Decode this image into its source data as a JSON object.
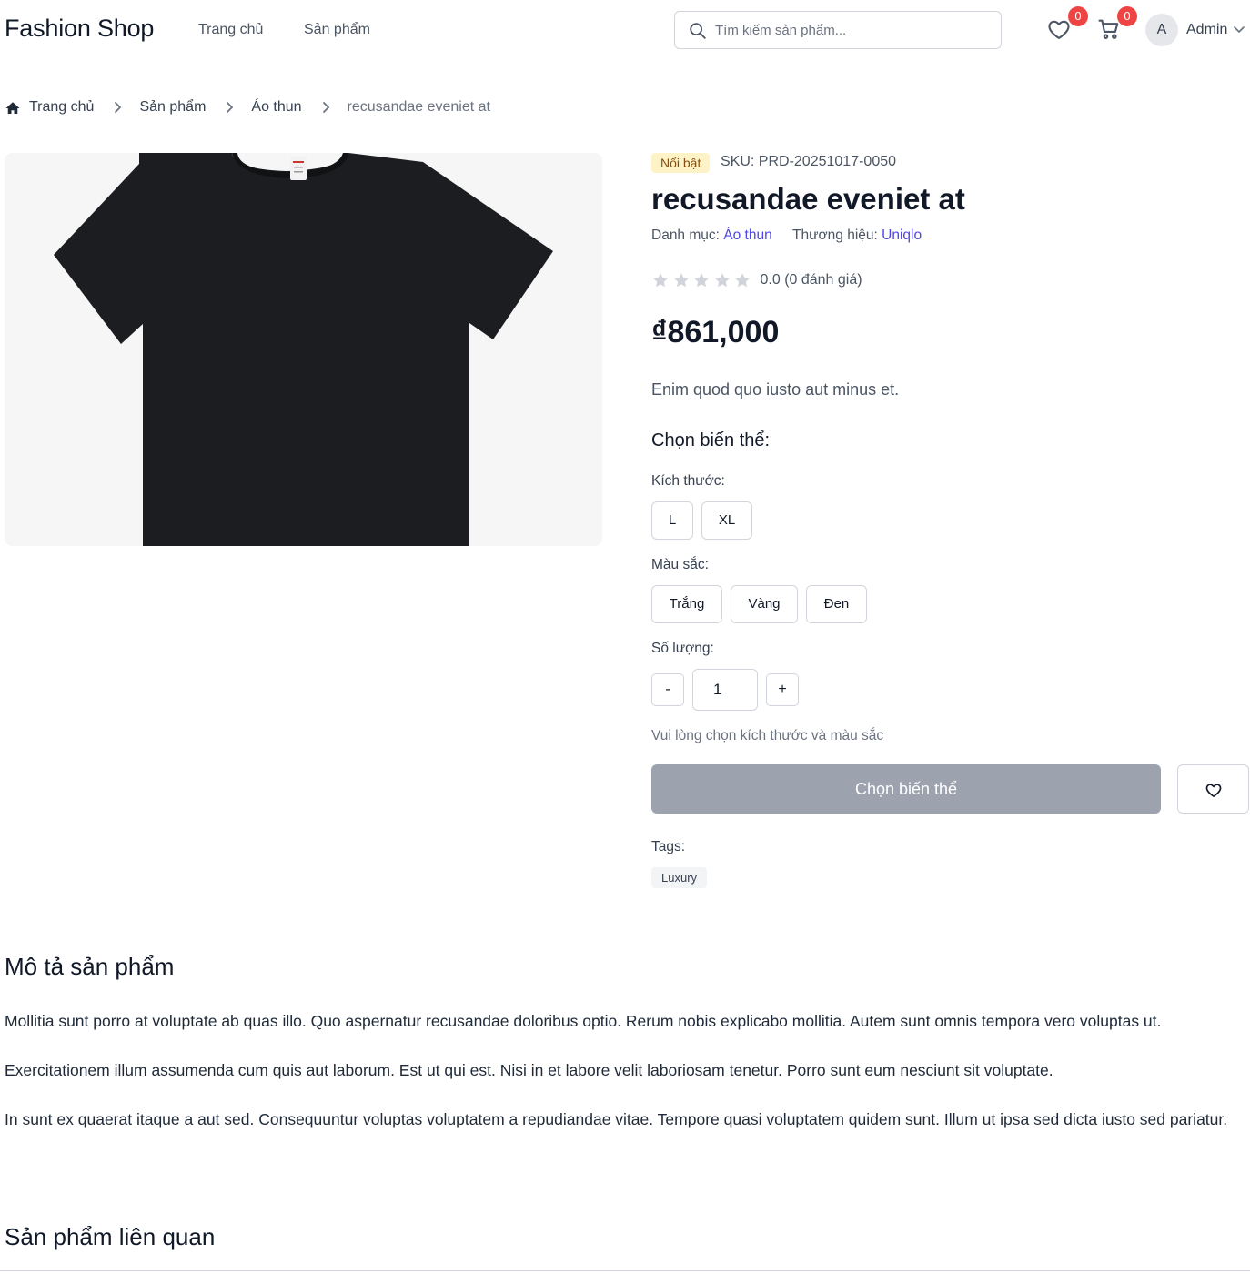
{
  "header": {
    "logo": "Fashion Shop",
    "nav": [
      {
        "label": "Trang chủ"
      },
      {
        "label": "Sản phẩm"
      }
    ],
    "search_placeholder": "Tìm kiếm sản phẩm...",
    "wishlist_count": "0",
    "cart_count": "0",
    "user_initial": "A",
    "user_name": "Admin"
  },
  "breadcrumb": {
    "home": "Trang chủ",
    "items": [
      "Sản phẩm",
      "Áo thun"
    ],
    "current": "recusandae eveniet at"
  },
  "product": {
    "badge": "Nổi bật",
    "sku": "SKU: PRD-20251017-0050",
    "title": "recusandae eveniet at",
    "category_label": "Danh mục:",
    "category": "Áo thun",
    "brand_label": "Thương hiệu:",
    "brand": "Uniqlo",
    "rating": 0,
    "rating_text": "0.0 (0 đánh giá)",
    "price": "₫861,000",
    "short_description": "Enim quod quo iusto aut minus et.",
    "variant_heading": "Chọn biến thể:",
    "size_label": "Kích thước:",
    "sizes": [
      "L",
      "XL"
    ],
    "color_label": "Màu sắc:",
    "colors": [
      "Trắng",
      "Vàng",
      "Đen"
    ],
    "quantity_label": "Số lượng:",
    "quantity": "1",
    "qty_minus": "-",
    "qty_plus": "+",
    "hint": "Vui lòng chọn kích thước và màu sắc",
    "add_button": "Chọn biến thể",
    "tags_label": "Tags:",
    "tags": [
      "Luxury"
    ]
  },
  "description": {
    "title": "Mô tả sản phẩm",
    "paragraphs": [
      "Mollitia sunt porro at voluptate ab quas illo. Quo aspernatur recusandae doloribus optio. Rerum nobis explicabo mollitia. Autem sunt omnis tempora vero voluptas ut.",
      "Exercitationem illum assumenda cum quis aut laborum. Est ut qui est. Nisi in et labore velit laboriosam tenetur. Porro sunt eum nesciunt sit voluptate.",
      "In sunt ex quaerat itaque a aut sed. Consequuntur voluptas voluptatem a repudiandae vitae. Tempore quasi voluptatem quidem sunt. Illum ut ipsa sed dicta iusto sed pariatur."
    ]
  },
  "related": {
    "title": "Sản phẩm liên quan"
  },
  "colors": {
    "accent_link": "#4f46e5",
    "badge_bg": "#fef3c7",
    "notification_badge": "#ef4444",
    "disabled_button": "#9ca3af",
    "star_empty": "#d1d5db"
  },
  "icons": {
    "search": "search-icon",
    "wishlist": "heart-icon",
    "cart": "cart-icon",
    "home": "home-icon",
    "separator": "chevron-right-icon",
    "user_menu": "chevron-down-icon",
    "star": "star-icon"
  }
}
